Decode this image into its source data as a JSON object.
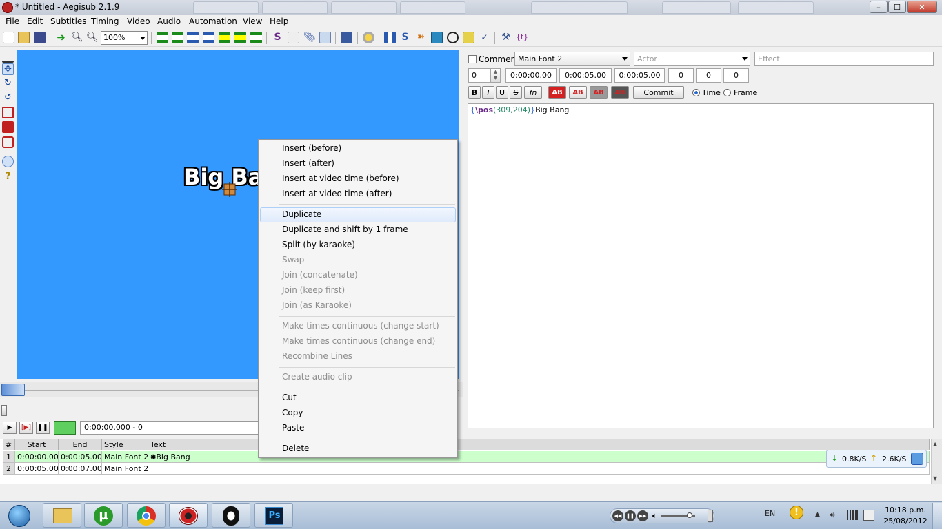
{
  "window": {
    "title": "* Untitled - Aegisub 2.1.9",
    "controls": {
      "minimize": "–",
      "maximize": "☐",
      "close": "✕"
    }
  },
  "menubar": [
    "File",
    "Edit",
    "Subtitles",
    "Timing",
    "Video",
    "Audio",
    "Automation",
    "View",
    "Help"
  ],
  "toolbar": {
    "zoom": "100%"
  },
  "video": {
    "subtitle_text": "Big Bang",
    "position": "0:00:00.000 - 0"
  },
  "editor": {
    "comment_label": "Comment",
    "style": "Main Font 2",
    "actor_placeholder": "Actor",
    "effect_placeholder": "Effect",
    "layer": "0",
    "start_time": "0:00:00.00",
    "end_time": "0:00:05.00",
    "duration": "0:00:05.00",
    "margin_l": "0",
    "margin_r": "0",
    "margin_v": "0",
    "format_buttons": {
      "bold": "B",
      "italic": "I",
      "underline": "U",
      "strikeout": "S",
      "font": "fn",
      "color1": "AB",
      "color2": "AB",
      "color3": "AB",
      "color4": "AB"
    },
    "commit_label": "Commit",
    "time_label": "Time",
    "frame_label": "Frame",
    "text": {
      "brace_open": "{",
      "tag": "\\pos",
      "args": "(309,204)",
      "brace_close": "}",
      "content": "Big Bang"
    }
  },
  "grid": {
    "headers": {
      "num": "#",
      "start": "Start",
      "end": "End",
      "style": "Style",
      "text": "Text"
    },
    "rows": [
      {
        "num": "1",
        "start": "0:00:00.00",
        "end": "0:00:05.00",
        "style": "Main Font 2",
        "text": "Big Bang"
      },
      {
        "num": "2",
        "start": "0:00:05.00",
        "end": "0:00:07.00",
        "style": "Main Font 2",
        "text": ""
      }
    ]
  },
  "context_menu": {
    "items": [
      {
        "label": "Insert (before)",
        "enabled": true
      },
      {
        "label": "Insert (after)",
        "enabled": true
      },
      {
        "label": "Insert at video time (before)",
        "enabled": true
      },
      {
        "label": "Insert at video time (after)",
        "enabled": true
      },
      {
        "label": "Duplicate",
        "enabled": true,
        "highlighted": true
      },
      {
        "label": "Duplicate and shift by 1 frame",
        "enabled": true
      },
      {
        "label": "Split (by karaoke)",
        "enabled": true
      },
      {
        "label": "Swap",
        "enabled": false
      },
      {
        "label": "Join (concatenate)",
        "enabled": false
      },
      {
        "label": "Join (keep first)",
        "enabled": false
      },
      {
        "label": "Join (as Karaoke)",
        "enabled": false
      },
      {
        "label": "Make times continuous (change start)",
        "enabled": false
      },
      {
        "label": "Make times continuous (change end)",
        "enabled": false
      },
      {
        "label": "Recombine Lines",
        "enabled": false
      },
      {
        "label": "Create audio clip",
        "enabled": false
      },
      {
        "label": "Cut",
        "enabled": true
      },
      {
        "label": "Copy",
        "enabled": true
      },
      {
        "label": "Paste",
        "enabled": true
      },
      {
        "label": "Delete",
        "enabled": true
      }
    ]
  },
  "netmeter": {
    "down": "0.8K/S",
    "up": "2.6K/S"
  },
  "taskbar": {
    "apps": [
      "explorer",
      "utorrent",
      "chrome",
      "aegisub",
      "qq",
      "photoshop"
    ],
    "photoshop_label": "Ps",
    "language": "EN",
    "time": "10:18 p.m.",
    "date": "25/08/2012"
  },
  "colors": {
    "video_bg": "#3399ff",
    "highlight": "#dfeafb",
    "grid_selected": "#ccffcc"
  }
}
